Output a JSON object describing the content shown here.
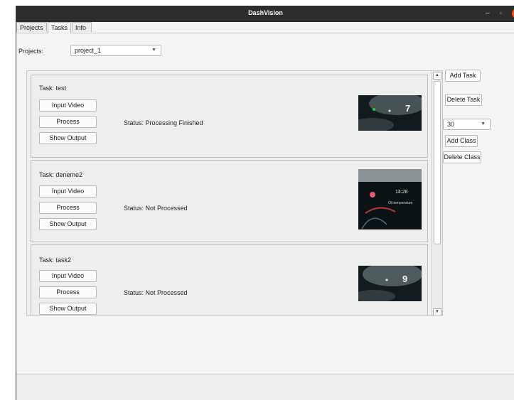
{
  "window": {
    "title": "DashVision",
    "minimize_glyph": "–",
    "maximize_glyph": "▫"
  },
  "tabs": [
    {
      "label": "Projects"
    },
    {
      "label": "Tasks"
    },
    {
      "label": "Info"
    }
  ],
  "active_tab": "Tasks",
  "project_selector": {
    "label": "Projects:",
    "value": "project_1"
  },
  "tasks": [
    {
      "title": "Task: test",
      "input_label": "Input Video",
      "process_label": "Process",
      "output_label": "Show Output",
      "status": "Status: Processing Finished",
      "thumb_text": "7"
    },
    {
      "title": "Task: deneme2",
      "input_label": "Input Video",
      "process_label": "Process",
      "output_label": "Show Output",
      "status": "Status: Not Processed",
      "thumb_time": "14:28",
      "thumb_caption": "Oil temperature"
    },
    {
      "title": "Task: task2",
      "input_label": "Input Video",
      "process_label": "Process",
      "output_label": "Show Output",
      "status": "Status: Not Processed",
      "thumb_text": "9"
    }
  ],
  "side_panel": {
    "add_task": "Add Task",
    "delete_task": "Delete Task",
    "class_select": "30",
    "add_class": "Add Class",
    "delete_class": "Delete Class"
  },
  "icons": {
    "close": "close-icon",
    "dropdown": "chevron-down-icon",
    "scroll_up": "arrow-up-icon",
    "scroll_down": "arrow-down-icon"
  },
  "colors": {
    "titlebar": "#2d2d2d",
    "close_button": "#e95420",
    "window_bg": "#f5f5f5"
  }
}
